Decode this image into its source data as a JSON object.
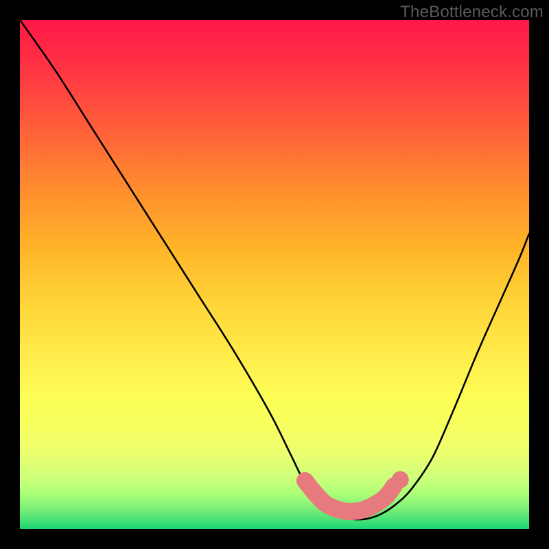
{
  "watermark": "TheBottleneck.com",
  "chart_data": {
    "type": "line",
    "title": "",
    "xlabel": "",
    "ylabel": "",
    "xlim": [
      0,
      100
    ],
    "ylim": [
      0,
      100
    ],
    "series": [
      {
        "name": "bottleneck-curve",
        "x": [
          0,
          7,
          14,
          21,
          28,
          35,
          42,
          49,
          53,
          56,
          59,
          62,
          65,
          68,
          71,
          74,
          77,
          81,
          85,
          90,
          94,
          98,
          100
        ],
        "values": [
          100,
          90,
          79,
          68,
          57,
          46,
          35,
          23,
          15,
          9,
          5,
          3,
          2,
          2,
          3,
          5,
          8,
          14,
          23,
          35,
          44,
          53,
          58
        ]
      }
    ],
    "highlight_band": {
      "name": "optimal-zone",
      "color": "#e77a7e",
      "x": [
        56,
        58,
        60,
        62,
        64,
        66,
        68,
        70,
        72,
        73.5
      ],
      "values": [
        9.5,
        7,
        5,
        4,
        3.5,
        3.5,
        4,
        5,
        6.5,
        8.5
      ]
    },
    "dot_radius_world": 1.6
  }
}
